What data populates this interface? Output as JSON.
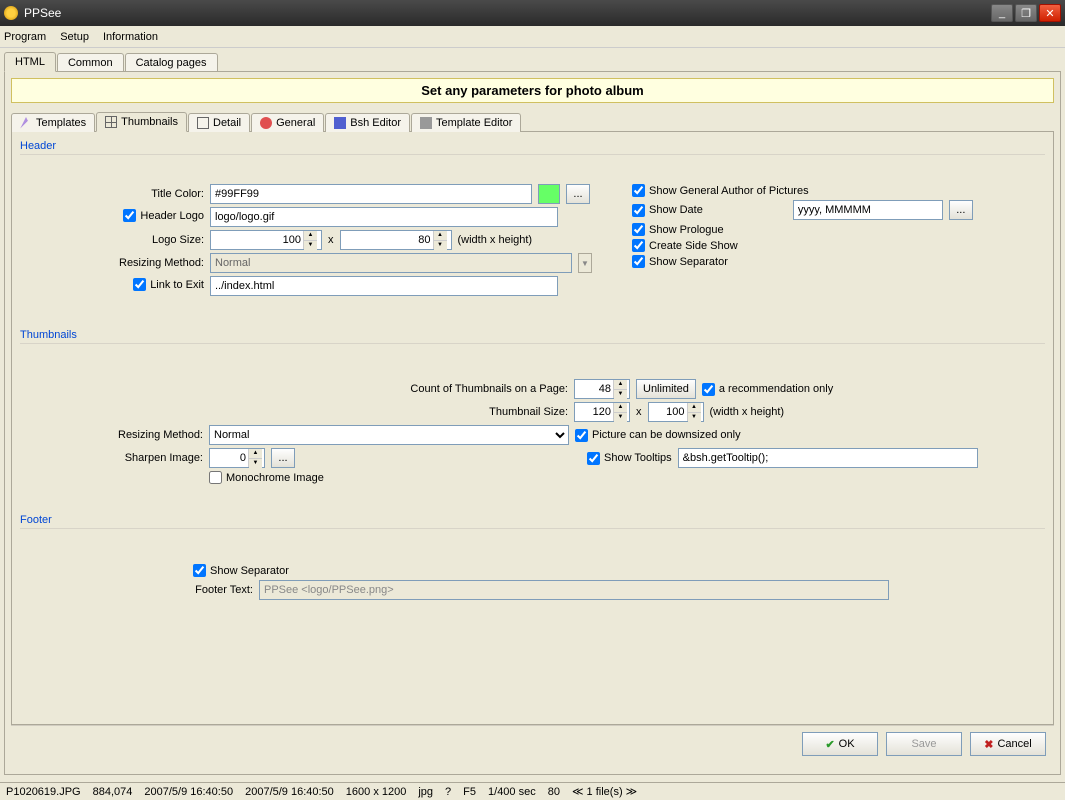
{
  "app": {
    "title": "PPSee"
  },
  "menu": {
    "program": "Program",
    "setup": "Setup",
    "information": "Information"
  },
  "topTabs": {
    "html": "HTML",
    "common": "Common",
    "catalog": "Catalog pages"
  },
  "banner": "Set any parameters for photo album",
  "subTabs": {
    "templates": "Templates",
    "thumbnails": "Thumbnails",
    "detail": "Detail",
    "general": "General",
    "bsh": "Bsh Editor",
    "template_editor": "Template Editor"
  },
  "header": {
    "title": "Header",
    "titleColorLabel": "Title Color:",
    "titleColor": "#99FF99",
    "headerLogoCheck": true,
    "headerLogoLabel": "Header Logo",
    "headerLogoPath": "logo/logo.gif",
    "logoSizeLabel": "Logo Size:",
    "logoW": "100",
    "logoH": "80",
    "whx": "x",
    "whNote": "(width x height)",
    "resizingLabel": "Resizing Method:",
    "resizingValue": "Normal",
    "linkToExitCheck": true,
    "linkToExitLabel": "Link to Exit",
    "linkToExitPath": "../index.html",
    "showAuthorCheck": true,
    "showAuthorLabel": "Show General Author of Pictures",
    "showDateCheck": true,
    "showDateLabel": "Show Date",
    "dateFormat": "yyyy, MMMMM",
    "showPrologueCheck": true,
    "showPrologueLabel": "Show Prologue",
    "slideShowCheck": true,
    "slideShowLabel": "Create Side Show",
    "showSepCheck": true,
    "showSepLabel": "Show Separator",
    "dots": "..."
  },
  "thumbs": {
    "title": "Thumbnails",
    "countLabel": "Count of Thumbnails on a Page:",
    "count": "48",
    "unlimited": "Unlimited",
    "recommendCheck": true,
    "recommendLabel": "a recommendation only",
    "sizeLabel": "Thumbnail Size:",
    "thumbW": "120",
    "thumbH": "100",
    "whx": "x",
    "whNote": "(width x height)",
    "resizingLabel": "Resizing Method:",
    "resizingValue": "Normal",
    "downsizedCheck": true,
    "downsizedLabel": "Picture can be downsized only",
    "sharpenLabel": "Sharpen Image:",
    "sharpen": "0",
    "tooltipsCheck": true,
    "tooltipsLabel": "Show Tooltips",
    "tooltipsValue": "&bsh.getTooltip();",
    "monoCheck": false,
    "monoLabel": "Monochrome Image",
    "dots": "..."
  },
  "footer": {
    "title": "Footer",
    "sepCheck": true,
    "sepLabel": "Show Separator",
    "textLabel": "Footer Text:",
    "textValue": "PPSee <logo/PPSee.png>"
  },
  "buttons": {
    "ok": "OK",
    "save": "Save",
    "cancel": "Cancel"
  },
  "status": {
    "file": "P1020619.JPG",
    "size": "884,074",
    "date1": "2007/5/9 16:40:50",
    "date2": "2007/5/9 16:40:50",
    "dims": "1600 x 1200",
    "ext": "jpg",
    "q": "?",
    "f": "F5",
    "shutter": "1/400 sec",
    "iso": "80",
    "nav": "≪ 1 file(s) ≫"
  }
}
